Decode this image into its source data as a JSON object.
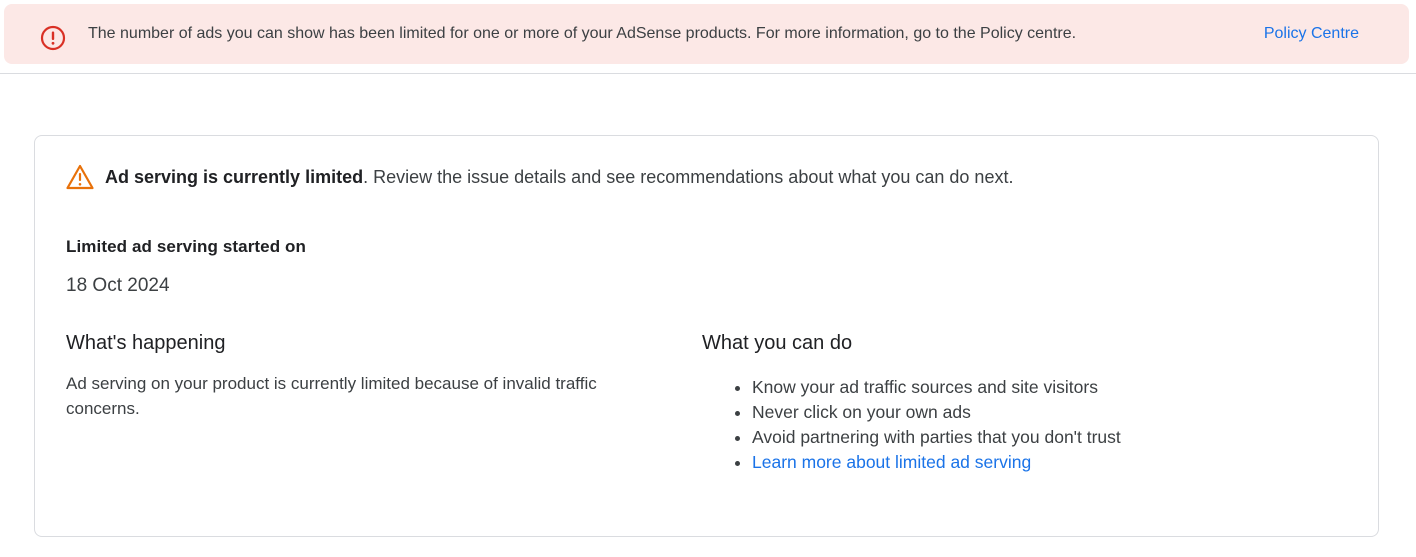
{
  "banner": {
    "icon": "error-circle-icon",
    "message": "The number of ads you can show has been limited for one or more of your AdSense products. For more information, go to the Policy centre.",
    "link_label": "Policy Centre",
    "background_color": "#fce8e6",
    "icon_color": "#d93025",
    "link_color": "#1a73e8"
  },
  "card": {
    "alert": {
      "icon": "warning-triangle-icon",
      "icon_color": "#e8710a",
      "bold_text": "Ad serving is currently limited",
      "text": ". Review the issue details and see recommendations about what you can do next."
    },
    "started": {
      "label": "Limited ad serving started on",
      "value": "18 Oct 2024"
    },
    "happening": {
      "heading": "What's happening",
      "body": "Ad serving on your product is currently limited because of invalid traffic concerns."
    },
    "todo": {
      "heading": "What you can do",
      "items": [
        "Know your ad traffic sources and site visitors",
        "Never click on your own ads",
        "Avoid partnering with parties that you don't trust"
      ],
      "learn_more_label": "Learn more about limited ad serving"
    }
  }
}
